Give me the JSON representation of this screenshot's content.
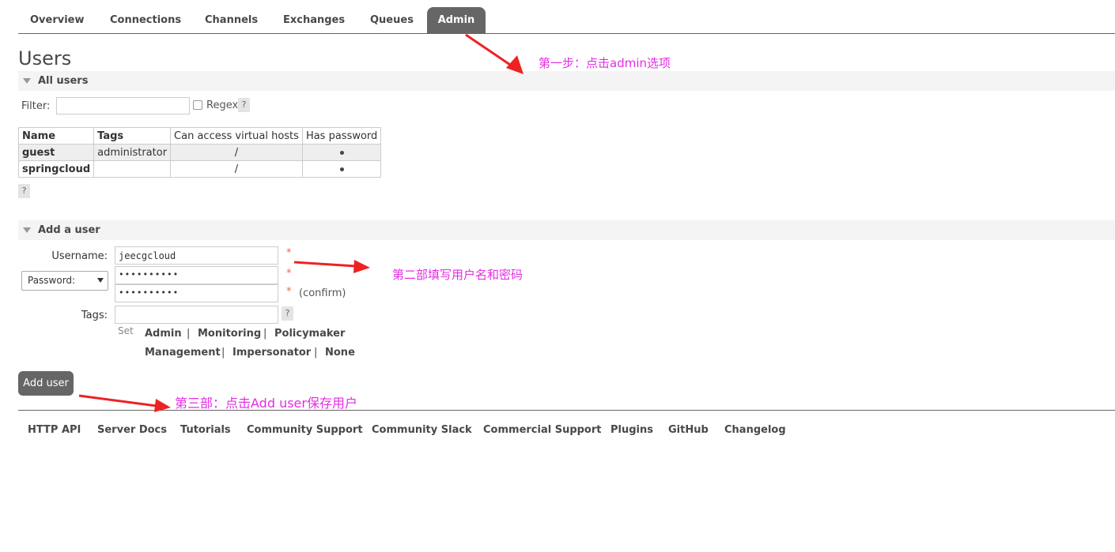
{
  "tabs": [
    "Overview",
    "Connections",
    "Channels",
    "Exchanges",
    "Queues",
    "Admin"
  ],
  "page_title": "Users",
  "all_users": {
    "title": "All users",
    "filter_label": "Filter:",
    "filter_value": "",
    "regex_label": "Regex",
    "help": "?"
  },
  "users_table": {
    "headers": [
      "Name",
      "Tags",
      "Can access virtual hosts",
      "Has password"
    ],
    "rows": [
      {
        "name": "guest",
        "tags": "administrator",
        "vhosts": "/"
      },
      {
        "name": "springcloud",
        "tags": "",
        "vhosts": "/"
      }
    ]
  },
  "add_user": {
    "title": "Add a user",
    "username_label": "Username:",
    "username_value": "jeecgcloud",
    "password_select": "Password:",
    "password_mask": "••••••••••",
    "confirm_mask": "••••••••••",
    "confirm_label": "(confirm)",
    "tags_label": "Tags:",
    "tags_value": "",
    "required_mark": "*",
    "set_label": "Set",
    "tag_options": [
      "Admin",
      "Monitoring",
      "Policymaker",
      "Management",
      "Impersonator",
      "None"
    ],
    "separator": "|",
    "submit_label": "Add user"
  },
  "footer_links": [
    "HTTP API",
    "Server Docs",
    "Tutorials",
    "Community Support",
    "Community Slack",
    "Commercial Support",
    "Plugins",
    "GitHub",
    "Changelog"
  ],
  "annotations": {
    "step1": "第一步：点击admin选项",
    "step2": "第二部填写用户名和密码",
    "step3": "第三部：点击Add user保存用户"
  },
  "colors": {
    "accent": "#666666",
    "annotation": "#e52de5",
    "arrow": "#ee2222"
  }
}
